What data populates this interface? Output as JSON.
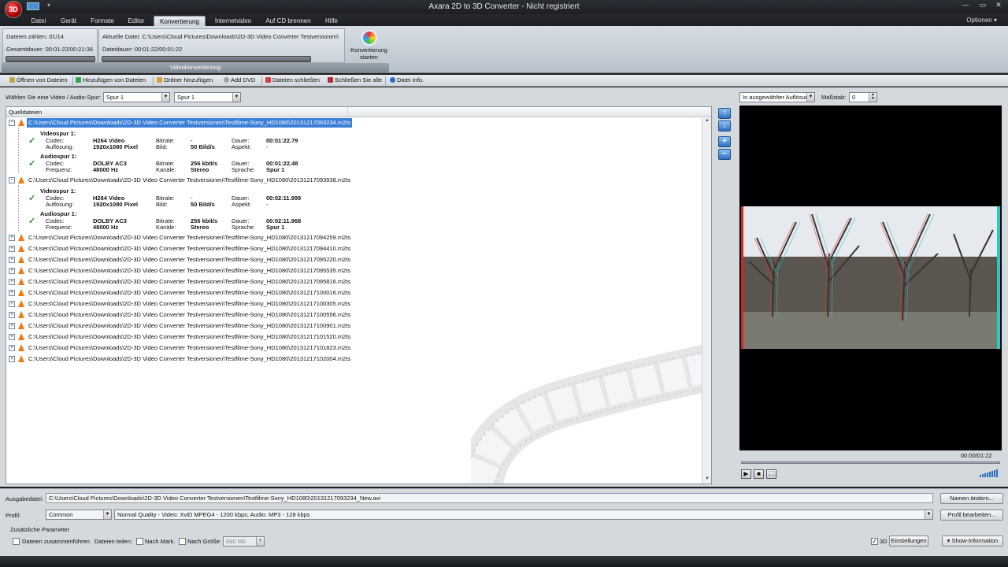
{
  "window": {
    "title": "Axara 2D to 3D Converter - Nicht registriert",
    "logo": "3D"
  },
  "menu": {
    "tabs": [
      "Datei",
      "Gerät",
      "Formate",
      "Editor",
      "Konvertierung",
      "Internetvideo",
      "Auf CD brennen",
      "Hilfe"
    ],
    "active": "Konvertierung",
    "options": "Optionen ▾"
  },
  "ribbon": {
    "files_count": "Dateien zählen: 01/14",
    "total_duration": "Gesamtdauer: 00:01:22/00:21:36",
    "current_file": "Aktuelle Datei: C:\\Users\\Cloud Pictures\\Downloads\\2D-3D Video Converter Testversionen\\",
    "file_duration": "Dateidauer: 00:01:22/00:01:22",
    "group_label": "Videokonvertierung",
    "convert_label_1": "Konvertierung",
    "convert_label_2": "starten"
  },
  "toolbar": {
    "open": "Öffnen von Dateien",
    "add_files": "Hinzufügen von Dateien",
    "add_folder": "Ordner hinzufügen",
    "add_dvd": "Add DVD",
    "close_files": "Dateien schließen",
    "close_all": "Schließen Sie alle",
    "file_info": "Datei Info."
  },
  "track_select": {
    "label": "Wählen Sie eine Video / Audio-Spur:",
    "video": "Spur 1",
    "audio": "Spur 1"
  },
  "list": {
    "header": "Quelldateien",
    "files": [
      "C:\\Users\\Cloud Pictures\\Downloads\\2D-3D Video Converter Testversionen\\Testfilme-Sony_HD1080\\20131217093234.m2ts",
      "C:\\Users\\Cloud Pictures\\Downloads\\2D-3D Video Converter Testversionen\\Testfilme-Sony_HD1080\\20131217093938.m2ts",
      "C:\\Users\\Cloud Pictures\\Downloads\\2D-3D Video Converter Testversionen\\Testfilme-Sony_HD1080\\20131217094259.m2ts",
      "C:\\Users\\Cloud Pictures\\Downloads\\2D-3D Video Converter Testversionen\\Testfilme-Sony_HD1080\\20131217094410.m2ts",
      "C:\\Users\\Cloud Pictures\\Downloads\\2D-3D Video Converter Testversionen\\Testfilme-Sony_HD1080\\20131217095220.m2ts",
      "C:\\Users\\Cloud Pictures\\Downloads\\2D-3D Video Converter Testversionen\\Testfilme-Sony_HD1080\\20131217095535.m2ts",
      "C:\\Users\\Cloud Pictures\\Downloads\\2D-3D Video Converter Testversionen\\Testfilme-Sony_HD1080\\20131217095816.m2ts",
      "C:\\Users\\Cloud Pictures\\Downloads\\2D-3D Video Converter Testversionen\\Testfilme-Sony_HD1080\\20131217100016.m2ts",
      "C:\\Users\\Cloud Pictures\\Downloads\\2D-3D Video Converter Testversionen\\Testfilme-Sony_HD1080\\20131217100305.m2ts",
      "C:\\Users\\Cloud Pictures\\Downloads\\2D-3D Video Converter Testversionen\\Testfilme-Sony_HD1080\\20131217100556.m2ts",
      "C:\\Users\\Cloud Pictures\\Downloads\\2D-3D Video Converter Testversionen\\Testfilme-Sony_HD1080\\20131217100901.m2ts",
      "C:\\Users\\Cloud Pictures\\Downloads\\2D-3D Video Converter Testversionen\\Testfilme-Sony_HD1080\\20131217101520.m2ts",
      "C:\\Users\\Cloud Pictures\\Downloads\\2D-3D Video Converter Testversionen\\Testfilme-Sony_HD1080\\20131217101823.m2ts",
      "C:\\Users\\Cloud Pictures\\Downloads\\2D-3D Video Converter Testversionen\\Testfilme-Sony_HD1080\\20131217102004.m2ts"
    ],
    "details": [
      {
        "video_title": "Videospur 1:",
        "codec_l": "Codec:",
        "codec": "H264 Video",
        "res_l": "Auflösung:",
        "res": "1920x1080 Pixel",
        "vbitrate_l": "Bitrate:",
        "vbitrate": "-",
        "fps_l": "Bild:",
        "fps": "50 Bild/s",
        "vdur_l": "Dauer:",
        "vdur": "00:01:22.79",
        "aspect_l": "Aspekt:",
        "aspect": "-",
        "audio_title": "Audiospur 1:",
        "acodec_l": "Codec:",
        "acodec": "DOLBY AC3",
        "freq_l": "Frequenz:",
        "freq": "48000 Hz",
        "abitrate_l": "Bitrate:",
        "abitrate": "256 kbit/s",
        "chan_l": "Kanäle:",
        "chan": "Stereo",
        "adur_l": "Dauer:",
        "adur": "00:01:22.48",
        "lang_l": "Sprache:",
        "lang": "Spur 1"
      },
      {
        "video_title": "Videospur 1:",
        "codec_l": "Codec:",
        "codec": "H264 Video",
        "res_l": "Auflösung:",
        "res": "1920x1080 Pixel",
        "vbitrate_l": "Bitrate:",
        "vbitrate": "-",
        "fps_l": "Bild:",
        "fps": "50 Bild/s",
        "vdur_l": "Dauer:",
        "vdur": "00:02:11.999",
        "aspect_l": "Aspekt:",
        "aspect": "-",
        "audio_title": "Audiospur 1:",
        "acodec_l": "Codec:",
        "acodec": "DOLBY AC3",
        "freq_l": "Frequenz:",
        "freq": "48000 Hz",
        "abitrate_l": "Bitrate:",
        "abitrate": "256 kbit/s",
        "chan_l": "Kanäle:",
        "chan": "Stereo",
        "adur_l": "Dauer:",
        "adur": "00:02:11.968",
        "lang_l": "Sprache:",
        "lang": "Spur 1"
      }
    ]
  },
  "preview": {
    "resolution": "In ausgewählter Auflösur",
    "scale_label": "Maßstab:",
    "scale": "0",
    "time": "00:00/01:22",
    "progress": 0
  },
  "output": {
    "label": "Ausgabedatei:",
    "path": "C:\\Users\\Cloud Pictures\\Downloads\\2D-3D Video Converter Testversionen\\Testfilme-Sony_HD1080\\20131217093234_New.avi",
    "rename": "Namen ändern...",
    "profile_label": "Profil:",
    "profile": "Common",
    "quality": "Normal Quality - Video: XviD MPEG4 - 1200 kbps; Audio: MP3 - 128 kbps",
    "edit_profile": "Profil bearbeiten...",
    "params_title": "Zusätzliche Parameter",
    "merge": "Dateien zusammenführen",
    "split": "Dateien teilen:",
    "by_mark": "Nach Mark.",
    "by_size": "Nach Größe:",
    "size": "690 Mb",
    "three_d": "3D",
    "settings": "Einstellungen",
    "show_info": "Show-Information"
  },
  "colors": {
    "accent": "#3b7fd8",
    "chrome_dark": "#1e2126",
    "panel": "#d4d9de"
  }
}
